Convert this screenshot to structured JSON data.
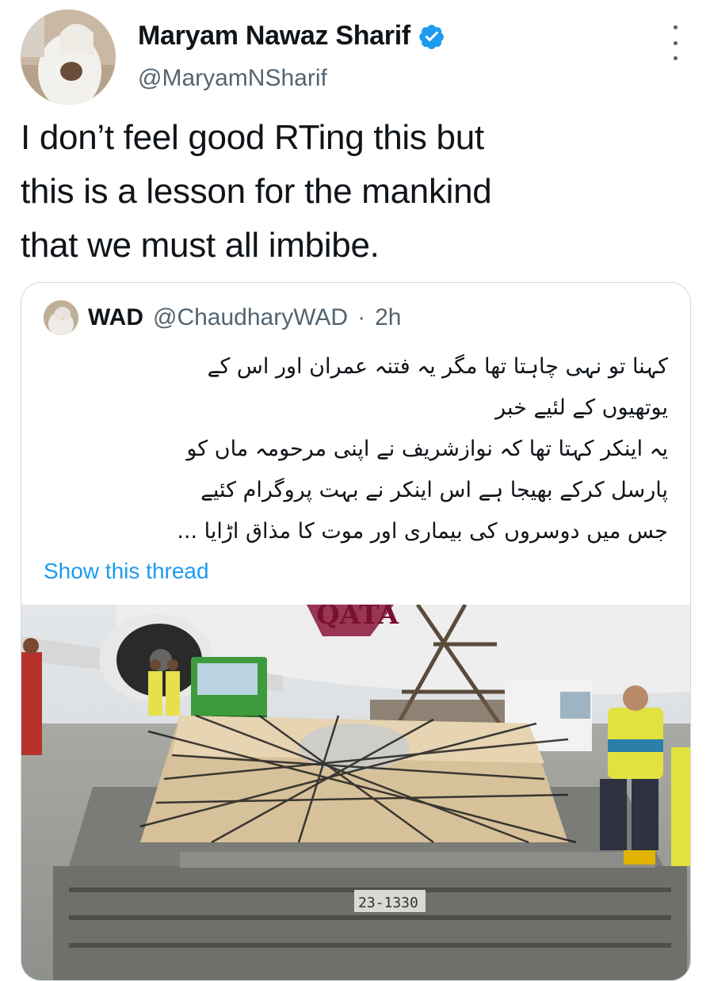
{
  "author": {
    "name": "Maryam Nawaz Sharif",
    "handle": "@MaryamNSharif",
    "verified_icon": "verified-badge-icon",
    "avatar_icon": "profile-photo"
  },
  "tweet": {
    "text_lines": [
      "I don’t feel good RTing this but",
      "this is a lesson for the mankind",
      "that we must all imbibe."
    ]
  },
  "quoted_tweet": {
    "name": "WAD",
    "handle": "@ChaudharyWAD",
    "separator": "·",
    "time": "2h",
    "text_lines": [
      "کہنا تو نہی چاہتا تھا  مگر یہ فتنہ عمران اور اس کے",
      "یوتھیوں کے لئیے خبر",
      "یہ اینکر کہتا تھا کہ نوازشریف نے اپنی مرحومہ ماں کو",
      "پارسل کرکے بھیجا ہے اس اینکر نے بہت پروگرام کئیے",
      "جس میں دوسروں کی بیماری اور موت کا مذاق اڑایا ..."
    ],
    "show_thread": "Show this thread",
    "image": {
      "description_icon": "airport-cargo-photo",
      "airline_letters": "QATA",
      "container_label": "23-1330"
    }
  },
  "colors": {
    "link": "#1d9bf0",
    "verified": "#1d9bf0",
    "secondary_text": "#536471",
    "border": "#cfd9de"
  }
}
